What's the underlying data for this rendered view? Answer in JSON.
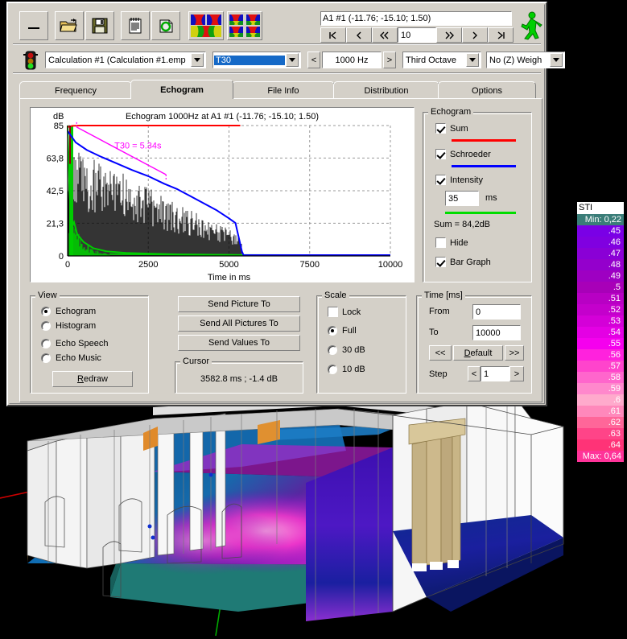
{
  "app": {
    "toolbar_icons": [
      {
        "name": "minimize-icon",
        "glyph": "minimize"
      },
      {
        "name": "open-folder-icon",
        "glyph": "folder-open"
      },
      {
        "name": "save-disk-icon",
        "glyph": "floppy"
      },
      {
        "name": "notepad-icon",
        "glyph": "notepad"
      },
      {
        "name": "recalculate-icon",
        "glyph": "recalc"
      },
      {
        "name": "color-map-icon",
        "glyph": "colormap"
      },
      {
        "name": "multi-map-icon",
        "glyph": "multimap"
      }
    ],
    "navigation": {
      "label": "A1 #1  (-11.76; -15.10; 1.50)",
      "first_label": "I<",
      "prev_label": "<",
      "prev_fast_label": "<<",
      "value": "10",
      "next_fast_label": ">>",
      "next_label": ">",
      "last_label": ">I"
    },
    "runner_icon": "running-man-icon",
    "traffic_light_icon": "traffic-light-icon",
    "selectors": {
      "calculation": "Calculation #1 (Calculation #1.emp",
      "parameter": "T30",
      "frequency": "1000 Hz",
      "freq_prev": "<",
      "freq_next": ">",
      "bandwidth": "Third Octave",
      "weighting": "No (Z) Weigh"
    }
  },
  "tabs": [
    {
      "label": "Frequency",
      "active": false
    },
    {
      "label": "Echogram",
      "active": true
    },
    {
      "label": "File Info",
      "active": false
    },
    {
      "label": "Distribution",
      "active": false
    },
    {
      "label": "Options",
      "active": false
    }
  ],
  "chart_data": {
    "type": "line",
    "title": "Echogram 1000Hz  at A1 #1  (-11.76; -15.10; 1.50)",
    "xlabel": "Time in ms",
    "ylabel": "dB",
    "xlim": [
      0,
      10000
    ],
    "ylim": [
      0,
      85
    ],
    "xticks": [
      "0",
      "2500",
      "5000",
      "7500",
      "10000"
    ],
    "yticks": [
      "85",
      "63,8",
      "42,5",
      "21,3",
      "0"
    ],
    "grid": true,
    "annotation": "T30 = 5.34s",
    "annotation_color": "#ff00ff",
    "series": [
      {
        "name": "Sum",
        "color": "#ff0000"
      },
      {
        "name": "Schroeder",
        "color": "#0000ff"
      },
      {
        "name": "Intensity",
        "color": "#00cc00"
      },
      {
        "name": "Echogram",
        "color": "#000000"
      },
      {
        "name": "T30 regression",
        "color": "#ff00ff"
      }
    ],
    "schroeder_points": [
      [
        0,
        81.5
      ],
      [
        250,
        74.0
      ],
      [
        600,
        69.0
      ],
      [
        1000,
        65.0
      ],
      [
        1500,
        60.5
      ],
      [
        2000,
        56.0
      ],
      [
        2500,
        52.0
      ],
      [
        3000,
        47.0
      ],
      [
        3400,
        43.5
      ],
      [
        3800,
        39.0
      ],
      [
        4200,
        34.5
      ],
      [
        4600,
        30.0
      ],
      [
        5000,
        24.5
      ],
      [
        5200,
        21.5
      ],
      [
        5400,
        3.0
      ],
      [
        5450,
        0.5
      ],
      [
        10000,
        0.5
      ]
    ],
    "sum_points": [
      [
        0,
        84.0
      ],
      [
        150,
        84.8
      ],
      [
        400,
        85.0
      ],
      [
        900,
        85.0
      ],
      [
        2000,
        85.0
      ],
      [
        3500,
        85.0
      ],
      [
        5000,
        85.0
      ],
      [
        5350,
        85.0
      ]
    ],
    "t30_line": [
      [
        280,
        84.0
      ],
      [
        3050,
        53.0
      ]
    ],
    "intensity_points": [
      [
        0,
        85.0
      ],
      [
        60,
        42.0
      ],
      [
        120,
        18.0
      ],
      [
        200,
        22.0
      ],
      [
        300,
        14.0
      ],
      [
        500,
        9.0
      ],
      [
        800,
        5.0
      ],
      [
        1200,
        3.0
      ],
      [
        1800,
        2.0
      ],
      [
        2500,
        1.5
      ],
      [
        3500,
        1.0
      ],
      [
        4500,
        0.8
      ],
      [
        5300,
        0.6
      ],
      [
        10000,
        0.5
      ]
    ]
  },
  "echogram_panel": {
    "title": "Echogram",
    "sum": {
      "label": "Sum",
      "checked": true,
      "color": "#ff0000"
    },
    "schroeder": {
      "label": "Schroeder",
      "checked": true,
      "color": "#0000ff"
    },
    "intensity": {
      "label": "Intensity",
      "checked": true,
      "color": "#00dd00"
    },
    "intensity_value": "35",
    "intensity_unit": "ms",
    "sum_readout": "Sum = 84,2dB",
    "hide": {
      "label": "Hide",
      "checked": false
    },
    "bar_graph": {
      "label": "Bar Graph",
      "checked": true
    }
  },
  "view_panel": {
    "title": "View",
    "options": [
      {
        "label": "Echogram",
        "selected": true
      },
      {
        "label": "Histogram",
        "selected": false
      },
      {
        "label": "Echo Speech",
        "selected": false
      },
      {
        "label": "Echo Music",
        "selected": false
      }
    ],
    "redraw_button": "Redraw",
    "redraw_accel": "R"
  },
  "actions": {
    "send_picture": "Send Picture To",
    "send_all_pictures": "Send All Pictures To",
    "send_values": "Send Values To"
  },
  "cursor_panel": {
    "title": "Cursor",
    "value": "3582.8 ms ; -1.4 dB"
  },
  "scale_panel": {
    "title": "Scale",
    "lock": {
      "label": "Lock",
      "checked": false
    },
    "options": [
      {
        "label": "Full",
        "selected": true
      },
      {
        "label": "30 dB",
        "selected": false
      },
      {
        "label": "10 dB",
        "selected": false
      }
    ]
  },
  "time_panel": {
    "title": "Time [ms]",
    "from_label": "From",
    "from_value": "0",
    "to_label": "To",
    "to_value": "10000",
    "prev_label": "<<",
    "default_label": "Default",
    "next_label": ">>",
    "step_label": "Step",
    "step_value": "1",
    "step_prev": "<",
    "step_next": ">"
  },
  "sti_legend": {
    "title": "STI",
    "min_label": "Min:  0,22",
    "max_label": "Max:  0,64",
    "min_color": "#3a7d78",
    "max_color": "#ff3399",
    "rows": [
      {
        "label": ".45",
        "color": "#7a00e6"
      },
      {
        "label": ".46",
        "color": "#8000e0"
      },
      {
        "label": ".47",
        "color": "#8a00d6"
      },
      {
        "label": ".48",
        "color": "#9400cc"
      },
      {
        "label": ".49",
        "color": "#9e00c2"
      },
      {
        "label": ".5",
        "color": "#a800b8"
      },
      {
        "label": ".51",
        "color": "#b800c4"
      },
      {
        "label": ".52",
        "color": "#c400cc"
      },
      {
        "label": ".53",
        "color": "#d400d8"
      },
      {
        "label": ".54",
        "color": "#e400e4"
      },
      {
        "label": ".55",
        "color": "#f500ee"
      },
      {
        "label": ".56",
        "color": "#ff22dd"
      },
      {
        "label": ".57",
        "color": "#ff44cc"
      },
      {
        "label": ".58",
        "color": "#ff66cc"
      },
      {
        "label": ".59",
        "color": "#ff88cc"
      },
      {
        "label": ".6",
        "color": "#ffaacc"
      },
      {
        "label": ".61",
        "color": "#ff88bb"
      },
      {
        "label": ".62",
        "color": "#ff6699"
      },
      {
        "label": ".63",
        "color": "#ff4488"
      },
      {
        "label": ".64",
        "color": "#ff3377"
      }
    ]
  }
}
